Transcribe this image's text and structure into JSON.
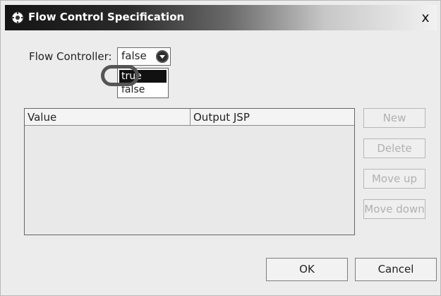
{
  "dialog": {
    "title": "Flow Control Specification",
    "close_label": "x"
  },
  "flow_controller": {
    "label": "Flow Controller:",
    "selected_value": "false",
    "options": [
      "true",
      "false"
    ]
  },
  "table": {
    "columns": [
      "Value",
      "Output JSP"
    ]
  },
  "side_buttons": {
    "new": "New",
    "delete": "Delete",
    "move_up": "Move up",
    "move_down": "Move down"
  },
  "footer": {
    "ok": "OK",
    "cancel": "Cancel"
  },
  "icons": {
    "title_icon": "settings-icon",
    "dropdown_arrow": "chevron-down-icon"
  },
  "colors": {
    "title_gradient_start": "#141414",
    "title_gradient_end": "#f2f2f2",
    "selection_bg": "#111111",
    "disabled_text": "#b0b0b0"
  }
}
